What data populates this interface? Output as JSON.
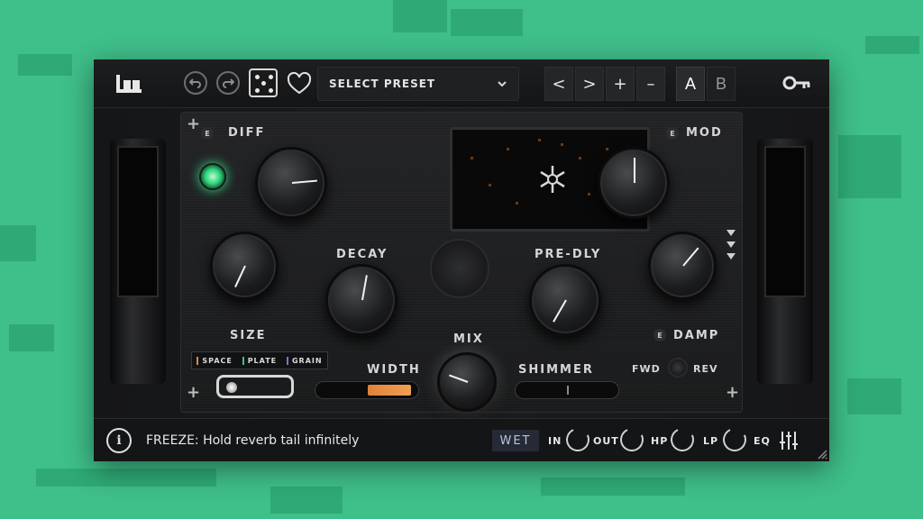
{
  "colors": {
    "background": "#3fbf8a",
    "panel": "#0e0f10",
    "led_green": "#39e08a",
    "width_slider": "#e08a3a",
    "wet_badge": "#262a36"
  },
  "toolbar": {
    "logo_icon": "brand-logo",
    "undo_icon": "undo",
    "redo_icon": "redo",
    "randomize_icon": "dice",
    "favorite_icon": "heart",
    "preset_label": "SELECT PRESET",
    "prev_label": "<",
    "next_label": ">",
    "add_label": "+",
    "remove_label": "–",
    "a_label": "A",
    "b_label": "B",
    "key_icon": "key"
  },
  "controls": {
    "diff": "DIFF",
    "mod": "MOD",
    "size": "SIZE",
    "decay": "DECAY",
    "pre_dly": "PRE-DLY",
    "damp": "DAMP",
    "mix": "MIX",
    "width": "WIDTH",
    "shimmer": "SHIMMER",
    "fwd": "FWD",
    "rev": "REV",
    "e_badge": "E"
  },
  "modes": {
    "space": "SPACE",
    "plate": "PLATE",
    "grain": "GRAIN"
  },
  "display": {
    "freeze_icon": "snowflake"
  },
  "bottom": {
    "info_icon": "i",
    "status_text": "FREEZE: Hold reverb tail infinitely",
    "wet_label": "WET",
    "in_label": "IN",
    "out_label": "OUT",
    "hp_label": "HP",
    "lp_label": "LP",
    "eq_label": "EQ",
    "eq_icon": "sliders"
  }
}
